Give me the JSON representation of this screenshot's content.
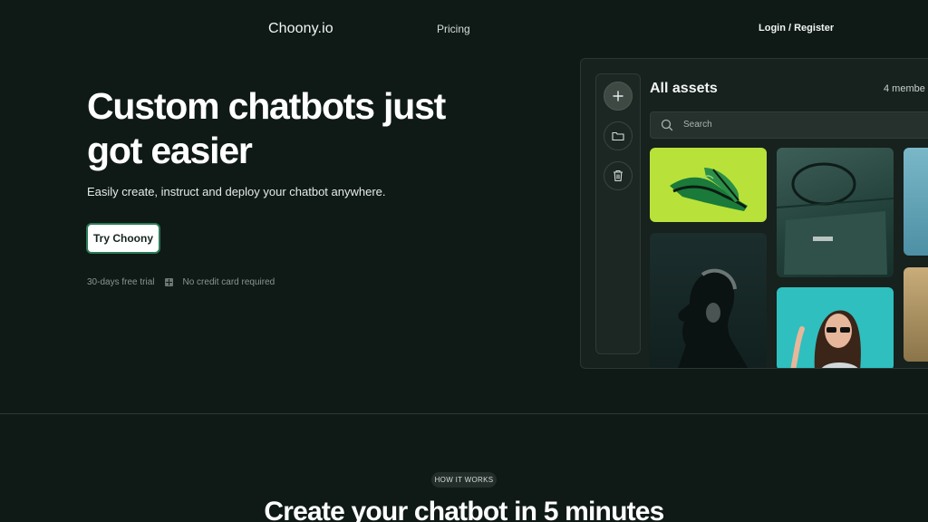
{
  "nav": {
    "logo": "Choony.io",
    "pricing": "Pricing",
    "login": "Login / Register"
  },
  "hero": {
    "title": "Custom chatbots just got easier",
    "subtitle": "Easily create, instruct and deploy your chatbot anywhere.",
    "cta": "Try Choony",
    "trial": "30-days free trial",
    "no_card": "No credit card required"
  },
  "app": {
    "title": "All assets",
    "members": "4 membe",
    "search_placeholder": "Search",
    "sidebar_icons": [
      "plus-icon",
      "folder-icon",
      "trash-icon"
    ]
  },
  "section": {
    "badge": "HOW IT WORKS",
    "title": "Create your chatbot in 5 minutes"
  },
  "colors": {
    "background": "#0f1a16",
    "accent_border": "#2b7a56",
    "shoe_tile": "#b8e23a",
    "teal_tile": "#2fbfbf"
  }
}
